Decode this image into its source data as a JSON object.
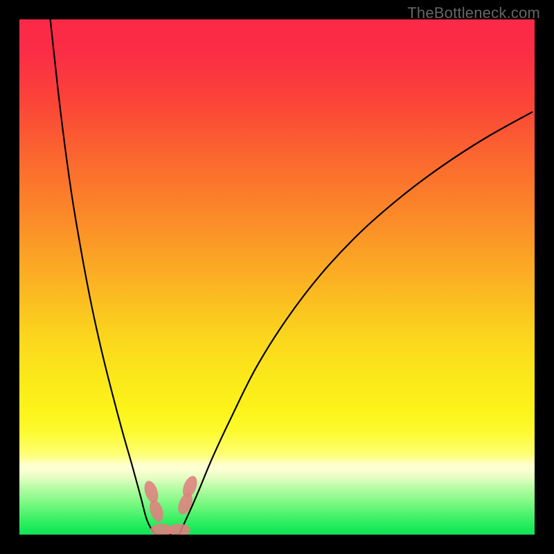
{
  "watermark": "TheBottleneck.com",
  "chart_data": {
    "type": "line",
    "title": "",
    "xlabel": "",
    "ylabel": "",
    "xlim": [
      0,
      100
    ],
    "ylim": [
      0,
      100
    ],
    "series": [
      {
        "name": "left-curve",
        "x": [
          6.0,
          8.0,
          10.0,
          12.0,
          14.0,
          16.0,
          18.0,
          20.0,
          22.0,
          23.5,
          24.7,
          25.8,
          26.5
        ],
        "y": [
          100.0,
          82.0,
          67.0,
          55.0,
          44.5,
          35.5,
          27.5,
          20.0,
          13.0,
          7.5,
          3.0,
          0.8,
          0.0
        ]
      },
      {
        "name": "right-curve",
        "x": [
          31.0,
          32.0,
          33.5,
          35.0,
          37.5,
          41.0,
          46.0,
          52.0,
          58.5,
          66.0,
          74.0,
          82.0,
          90.5,
          99.5
        ],
        "y": [
          0.0,
          2.2,
          5.5,
          9.0,
          15.0,
          22.5,
          32.5,
          42.0,
          50.5,
          58.5,
          65.5,
          71.5,
          77.0,
          82.0
        ]
      },
      {
        "name": "flat-segment",
        "x": [
          26.5,
          31.0
        ],
        "y": [
          0.0,
          0.0
        ]
      }
    ],
    "markers": [
      {
        "name": "left-upper",
        "cx": 25.6,
        "cy": 8.3,
        "rx": 1.2,
        "ry": 2.2,
        "angle": -18
      },
      {
        "name": "left-lower",
        "cx": 26.6,
        "cy": 4.6,
        "rx": 1.2,
        "ry": 2.2,
        "angle": -18
      },
      {
        "name": "right-upper",
        "cx": 33.1,
        "cy": 9.3,
        "rx": 1.2,
        "ry": 2.2,
        "angle": 22
      },
      {
        "name": "right-lower",
        "cx": 32.2,
        "cy": 6.0,
        "rx": 1.2,
        "ry": 2.2,
        "angle": 22
      },
      {
        "name": "bottom-left",
        "cx": 27.6,
        "cy": 0.9,
        "rx": 2.2,
        "ry": 1.2,
        "angle": 0
      },
      {
        "name": "bottom-right",
        "cx": 31.0,
        "cy": 0.9,
        "rx": 2.2,
        "ry": 1.2,
        "angle": 0
      }
    ],
    "marker_color": "#e08080",
    "curve_color": "#000000",
    "gradient_stops": [
      {
        "pos": 0,
        "color": "#fb2947"
      },
      {
        "pos": 50,
        "color": "#fbc020"
      },
      {
        "pos": 80,
        "color": "#fdfa30"
      },
      {
        "pos": 100,
        "color": "#13e356"
      }
    ]
  }
}
